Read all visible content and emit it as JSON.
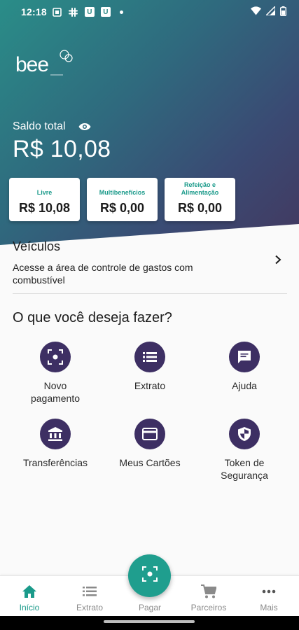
{
  "status_bar": {
    "time": "12:18",
    "notif_u1": "U",
    "notif_u2": "U"
  },
  "brand": {
    "logo_icon": "bee-logo"
  },
  "balance": {
    "label": "Saldo total",
    "value": "R$ 10,08"
  },
  "cards": [
    {
      "title": "Livre",
      "amount": "R$ 10,08"
    },
    {
      "title": "Multibenefícios",
      "amount": "R$ 0,00"
    },
    {
      "title": "Refeição e Alimentação",
      "amount": "R$ 0,00"
    }
  ],
  "veiculos": {
    "title": "Veículos",
    "description": "Acesse a área de controle de gastos com combustível"
  },
  "actions_title": "O que você deseja fazer?",
  "actions": [
    {
      "label": "Novo pagamento",
      "icon": "scan-icon"
    },
    {
      "label": "Extrato",
      "icon": "list-icon"
    },
    {
      "label": "Ajuda",
      "icon": "chat-icon"
    },
    {
      "label": "Transferências",
      "icon": "bank-icon"
    },
    {
      "label": "Meus Cartões",
      "icon": "card-icon"
    },
    {
      "label": "Token de Segurança",
      "icon": "shield-icon"
    }
  ],
  "bottom_nav": [
    {
      "label": "Início",
      "icon": "home-icon",
      "active": true
    },
    {
      "label": "Extrato",
      "icon": "list-icon",
      "active": false
    },
    {
      "label": "Pagar",
      "icon": "scan-icon",
      "active": false
    },
    {
      "label": "Parceiros",
      "icon": "cart-icon",
      "active": false
    },
    {
      "label": "Mais",
      "icon": "more-icon",
      "active": false
    }
  ],
  "colors": {
    "accent": "#1f9e8e",
    "action_circle": "#3d2f63",
    "gradient_start": "#2a8d88",
    "gradient_end": "#43385f"
  }
}
